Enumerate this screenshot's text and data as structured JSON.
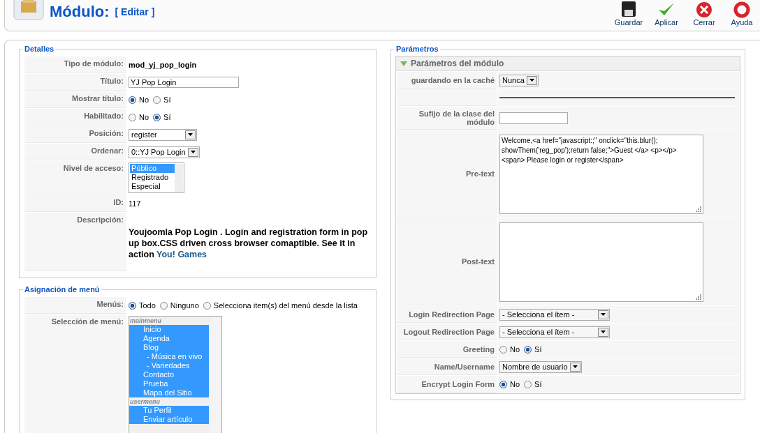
{
  "header": {
    "title": "Módulo:",
    "subtitle": "[ Editar ]",
    "toolbar": [
      {
        "kind": "save",
        "label": "Guardar"
      },
      {
        "kind": "apply",
        "label": "Aplicar"
      },
      {
        "kind": "close",
        "label": "Cerrar"
      },
      {
        "kind": "help",
        "label": "Ayuda"
      }
    ]
  },
  "details": {
    "legend": "Detalles",
    "rows": [
      {
        "kind": "text",
        "label": "Tipo de módulo:",
        "value": "mod_yj_pop_login"
      },
      {
        "kind": "input",
        "label": "Título:",
        "value": "YJ Pop Login"
      },
      {
        "kind": "radio",
        "label": "Mostrar título:",
        "options": [
          {
            "label": "No",
            "selected": true
          },
          {
            "label": "Sí",
            "selected": false
          }
        ]
      },
      {
        "kind": "radio",
        "label": "Habilitado:",
        "options": [
          {
            "label": "No",
            "selected": false
          },
          {
            "label": "Sí",
            "selected": true
          }
        ]
      },
      {
        "kind": "select",
        "label": "Posición:",
        "value": "register"
      },
      {
        "kind": "select",
        "label": "Ordenar:",
        "value": "0::YJ Pop Login"
      },
      {
        "kind": "listbox",
        "label": "Nivel de acceso:",
        "options": [
          {
            "label": "Público",
            "selected": true
          },
          {
            "label": "Registrado",
            "selected": false
          },
          {
            "label": "Especial",
            "selected": false
          }
        ]
      },
      {
        "kind": "plain",
        "label": "ID:",
        "value": "117"
      },
      {
        "kind": "description",
        "label": "Descripción:",
        "value": "Youjoomla Pop Login . Login and registration form in pop up box.CSS driven cross browser comaptible. See it in action ",
        "link": "You! Games"
      }
    ]
  },
  "menu_assignment": {
    "legend": "Asignación de menú",
    "menus_label": "Menús:",
    "menus_options": [
      {
        "label": "Todo",
        "selected": true
      },
      {
        "label": "Ninguno",
        "selected": false
      },
      {
        "label": "Selecciona item(s) del menú desde la lista",
        "selected": false
      }
    ],
    "selection_label": "Selección de menú:",
    "groups": [
      {
        "name": "mainmenu",
        "items": [
          {
            "label": "Inicio",
            "selected": true
          },
          {
            "label": "Agenda",
            "selected": true
          },
          {
            "label": "Blog",
            "selected": true,
            "children": [
              {
                "label": "- Música en vivo",
                "selected": true
              },
              {
                "label": "- Variedades",
                "selected": true
              }
            ]
          },
          {
            "label": "Contacto",
            "selected": true
          },
          {
            "label": "Prueba",
            "selected": true
          },
          {
            "label": "Mapa del Sitio",
            "selected": true
          }
        ]
      },
      {
        "name": "usermenu",
        "items": [
          {
            "label": "Tu Perfil",
            "selected": true
          },
          {
            "label": "Enviar artículo",
            "selected": true
          }
        ]
      }
    ]
  },
  "parameters": {
    "legend": "Parámetros",
    "panel_title": "Parámetros del módulo",
    "expanded": true,
    "rows": [
      {
        "kind": "select",
        "label": "guardando en la caché",
        "value": "Nunca"
      },
      {
        "kind": "separator"
      },
      {
        "kind": "input",
        "label": "Sufijo de la clase del módulo"
      },
      {
        "kind": "textarea",
        "label": "Pre-text",
        "value": "Welcome,<a href=\"javascript:;\" onclick=\"this.blur(); showThem('reg_pop');return false;\">Guest </a> <p></p> <span> Please login or register</span>"
      },
      {
        "kind": "textarea",
        "label": "Post-text"
      },
      {
        "kind": "wideselect",
        "label": "Login Redirection Page",
        "value": "- Selecciona el ítem -"
      },
      {
        "kind": "wideselect",
        "label": "Logout Redirection Page",
        "value": "- Selecciona el ítem -"
      },
      {
        "kind": "radio",
        "label": "Greeting",
        "options": [
          {
            "label": "No",
            "selected": false
          },
          {
            "label": "Sí",
            "selected": true
          }
        ]
      },
      {
        "kind": "select",
        "label": "Name/Username",
        "value": "Nombre de usuario"
      },
      {
        "kind": "radio",
        "label": "Encrypt Login Form",
        "options": [
          {
            "label": "No",
            "selected": true
          },
          {
            "label": "Sí",
            "selected": false
          }
        ]
      }
    ]
  }
}
